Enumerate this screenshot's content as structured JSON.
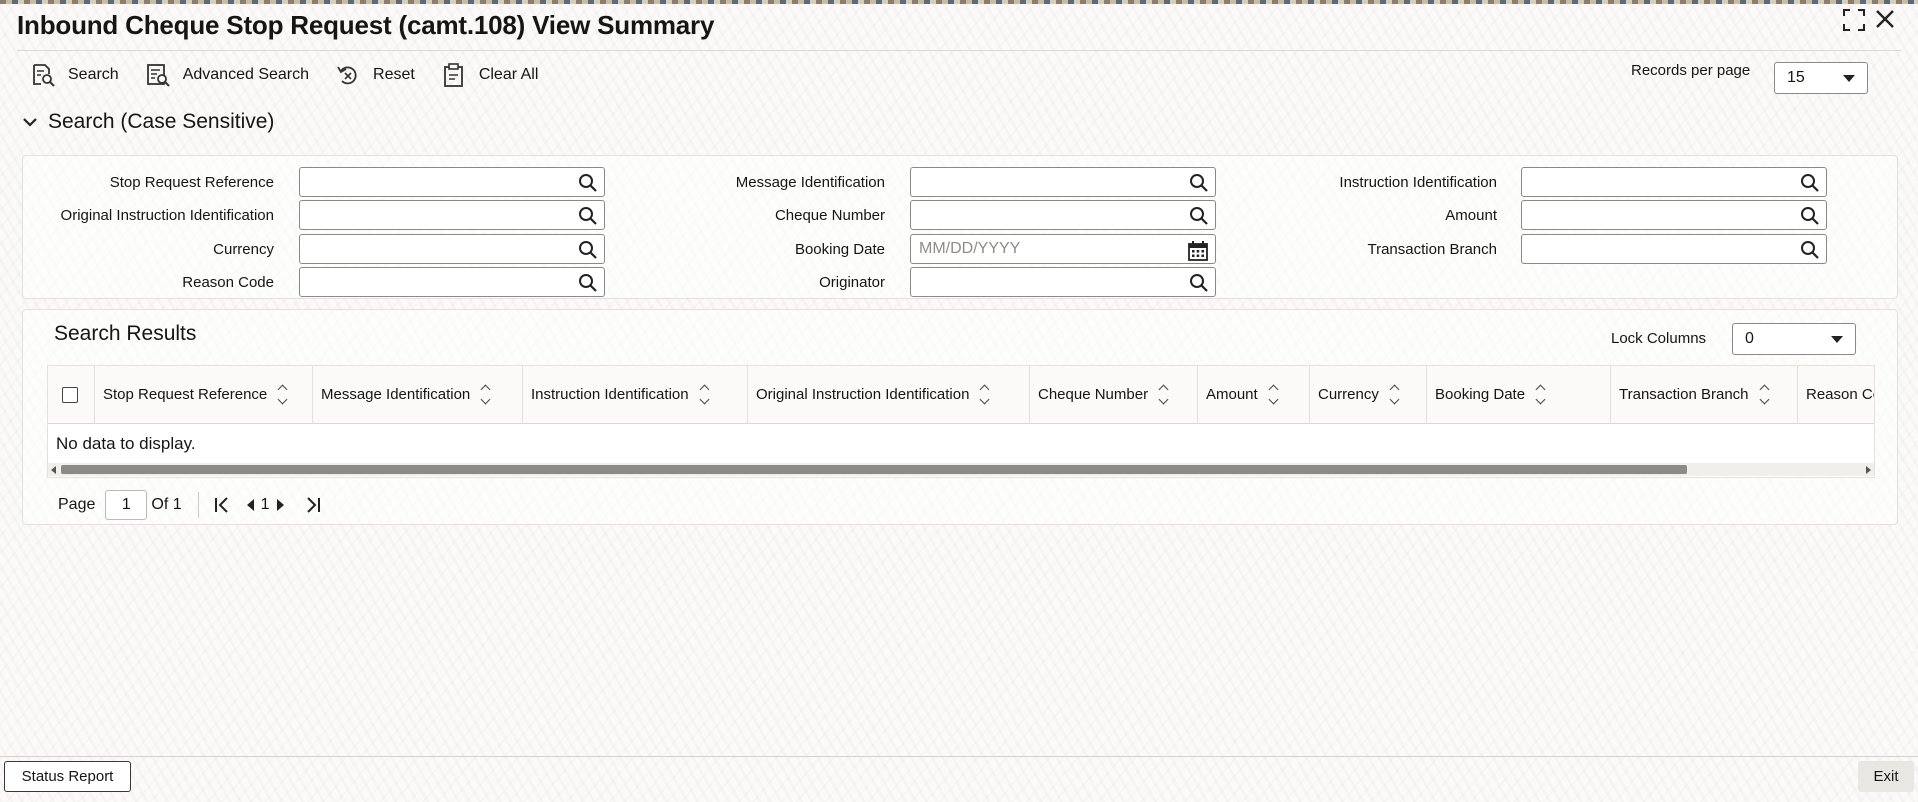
{
  "window": {
    "title": "Inbound Cheque Stop Request (camt.108) View Summary",
    "maximize_symbol": "⤢",
    "close_symbol": "✕"
  },
  "toolbar": {
    "items": [
      {
        "label": "Search",
        "icon": "search-form-icon"
      },
      {
        "label": "Advanced Search",
        "icon": "advanced-search-icon"
      },
      {
        "label": "Reset",
        "icon": "reset-icon"
      },
      {
        "label": "Clear All",
        "icon": "clipboard-clear-icon"
      }
    ],
    "records_per_page_label": "Records per page",
    "records_per_page_value": "15"
  },
  "search": {
    "heading": "Search (Case Sensitive)",
    "fields": {
      "stop_request_reference": {
        "label": "Stop Request Reference",
        "value": "",
        "placeholder": ""
      },
      "message_identification": {
        "label": "Message Identification",
        "value": "",
        "placeholder": ""
      },
      "instruction_identification": {
        "label": "Instruction Identification",
        "value": "",
        "placeholder": ""
      },
      "original_instruction_identification": {
        "label": "Original Instruction Identification",
        "value": "",
        "placeholder": ""
      },
      "cheque_number": {
        "label": "Cheque Number",
        "value": "",
        "placeholder": ""
      },
      "amount": {
        "label": "Amount",
        "value": "",
        "placeholder": ""
      },
      "currency": {
        "label": "Currency",
        "value": "",
        "placeholder": ""
      },
      "booking_date": {
        "label": "Booking Date",
        "value": "",
        "placeholder": "MM/DD/YYYY"
      },
      "transaction_branch": {
        "label": "Transaction Branch",
        "value": "",
        "placeholder": ""
      },
      "reason_code": {
        "label": "Reason Code",
        "value": "",
        "placeholder": ""
      },
      "originator": {
        "label": "Originator",
        "value": "",
        "placeholder": ""
      }
    }
  },
  "results": {
    "heading": "Search Results",
    "lock_columns_label": "Lock Columns",
    "lock_columns_value": "0",
    "columns": [
      "Stop Request Reference",
      "Message Identification",
      "Instruction Identification",
      "Original Instruction Identification",
      "Cheque Number",
      "Amount",
      "Currency",
      "Booking Date",
      "Transaction Branch",
      "Reason Co"
    ],
    "empty_message": "No data to display.",
    "pagination": {
      "page_label": "Page",
      "page_value": "1",
      "of_label": "Of 1",
      "current_page": "1"
    }
  },
  "footer": {
    "status_report_label": "Status Report",
    "exit_label": "Exit"
  }
}
